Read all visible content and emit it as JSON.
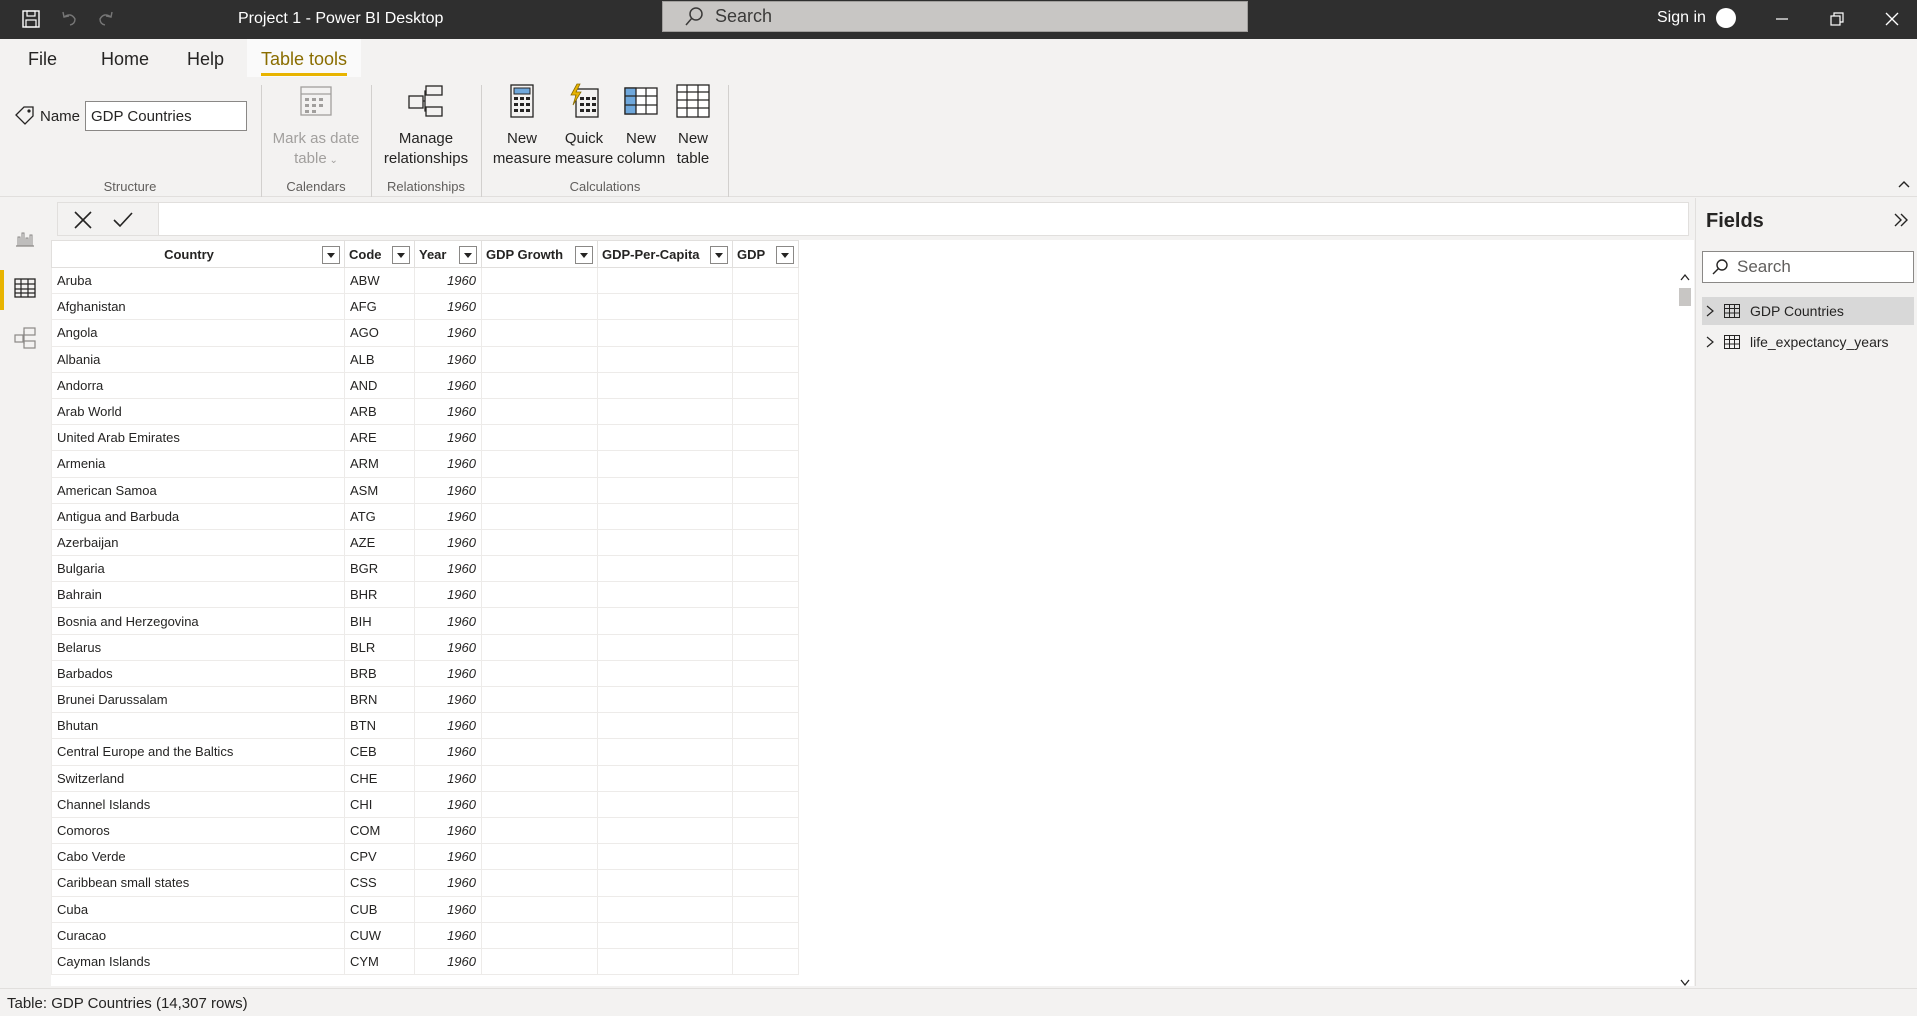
{
  "titlebar": {
    "title": "Project 1 - Power BI Desktop",
    "search_placeholder": "Search",
    "sign_in": "Sign in"
  },
  "menu": {
    "tabs": [
      "File",
      "Home",
      "Help",
      "Table tools"
    ],
    "active_tab": "Table tools"
  },
  "ribbon": {
    "name_label": "Name",
    "name_value": "GDP Countries",
    "groups": {
      "structure": "Structure",
      "calendars": "Calendars",
      "relationships": "Relationships",
      "calculations": "Calculations"
    },
    "buttons": {
      "mark_date_1": "Mark as date",
      "mark_date_2": "table",
      "manage_rel_1": "Manage",
      "manage_rel_2": "relationships",
      "new_measure_1": "New",
      "new_measure_2": "measure",
      "quick_measure_1": "Quick",
      "quick_measure_2": "measure",
      "new_column_1": "New",
      "new_column_2": "column",
      "new_table_1": "New",
      "new_table_2": "table"
    }
  },
  "grid": {
    "columns": [
      "Country",
      "Code",
      "Year",
      "GDP Growth",
      "GDP-Per-Capita",
      "GDP"
    ],
    "rows": [
      [
        "Aruba",
        "ABW",
        "1960"
      ],
      [
        "Afghanistan",
        "AFG",
        "1960"
      ],
      [
        "Angola",
        "AGO",
        "1960"
      ],
      [
        "Albania",
        "ALB",
        "1960"
      ],
      [
        "Andorra",
        "AND",
        "1960"
      ],
      [
        "Arab World",
        "ARB",
        "1960"
      ],
      [
        "United Arab Emirates",
        "ARE",
        "1960"
      ],
      [
        "Armenia",
        "ARM",
        "1960"
      ],
      [
        "American Samoa",
        "ASM",
        "1960"
      ],
      [
        "Antigua and Barbuda",
        "ATG",
        "1960"
      ],
      [
        "Azerbaijan",
        "AZE",
        "1960"
      ],
      [
        "Bulgaria",
        "BGR",
        "1960"
      ],
      [
        "Bahrain",
        "BHR",
        "1960"
      ],
      [
        "Bosnia and Herzegovina",
        "BIH",
        "1960"
      ],
      [
        "Belarus",
        "BLR",
        "1960"
      ],
      [
        "Barbados",
        "BRB",
        "1960"
      ],
      [
        "Brunei Darussalam",
        "BRN",
        "1960"
      ],
      [
        "Bhutan",
        "BTN",
        "1960"
      ],
      [
        "Central Europe and the Baltics",
        "CEB",
        "1960"
      ],
      [
        "Switzerland",
        "CHE",
        "1960"
      ],
      [
        "Channel Islands",
        "CHI",
        "1960"
      ],
      [
        "Comoros",
        "COM",
        "1960"
      ],
      [
        "Cabo Verde",
        "CPV",
        "1960"
      ],
      [
        "Caribbean small states",
        "CSS",
        "1960"
      ],
      [
        "Cuba",
        "CUB",
        "1960"
      ],
      [
        "Curacao",
        "CUW",
        "1960"
      ],
      [
        "Cayman Islands",
        "CYM",
        "1960"
      ]
    ]
  },
  "fields": {
    "title": "Fields",
    "search_placeholder": "Search",
    "tables": [
      "GDP Countries",
      "life_expectancy_years"
    ]
  },
  "status": {
    "text": "Table: GDP Countries (14,307 rows)"
  },
  "colors": {
    "accent": "#e8b400",
    "titlebar": "#2f2f2f"
  }
}
